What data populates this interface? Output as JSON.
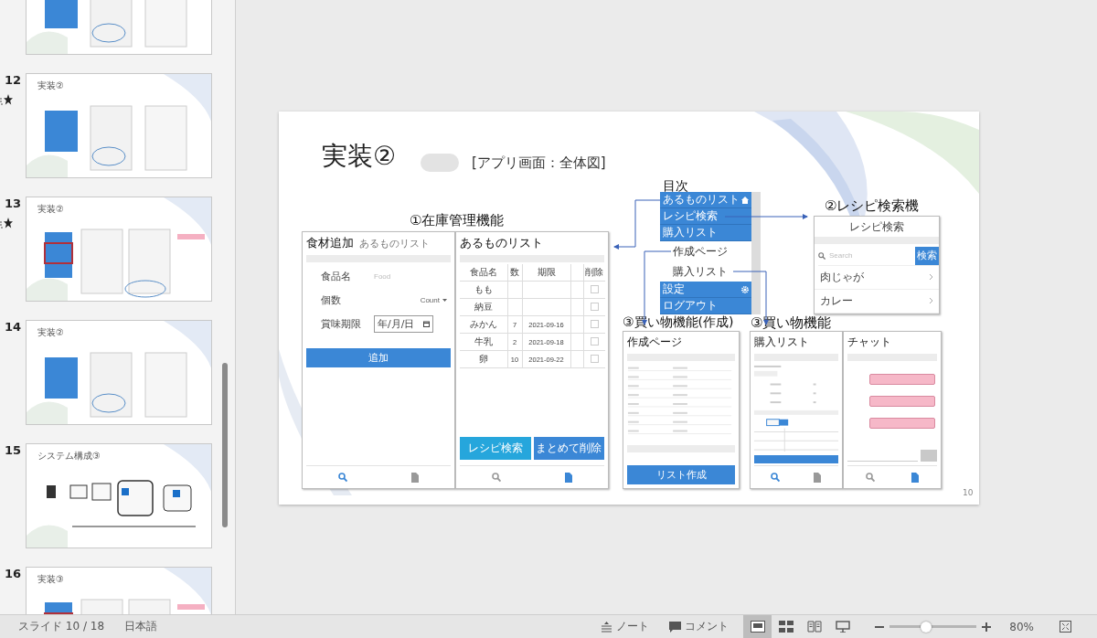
{
  "thumbnails": [
    {
      "starred": false
    },
    {
      "number": "12",
      "title": "実装②",
      "starred": true
    },
    {
      "number": "13",
      "title": "実装②",
      "starred": true
    },
    {
      "number": "14",
      "title": "実装②",
      "starred": false
    },
    {
      "number": "15",
      "title": "システム構成③",
      "starred": false
    },
    {
      "number": "16",
      "title": "実装③",
      "starred": false
    }
  ],
  "slide": {
    "title": "実装②",
    "subtitle": "[アプリ画面：全体図]",
    "page_number": "10",
    "inventory": {
      "label": "①在庫管理機能",
      "add_screen": {
        "title": "食材追加",
        "subtitle": "あるものリスト",
        "fields": [
          {
            "label": "食品名",
            "placeholder": "Food"
          },
          {
            "label": "個数",
            "value": "Count"
          },
          {
            "label": "賞味期限",
            "value": "年/月/日"
          }
        ],
        "button": "追加"
      },
      "list_screen": {
        "title": "あるものリスト",
        "headers": {
          "name": "食品名",
          "count": "数",
          "expires": "期限",
          "delete": "削除"
        },
        "rows": [
          {
            "name": "もも",
            "checked": false
          },
          {
            "name": "納豆",
            "checked": false
          },
          {
            "name": "みかん",
            "count": "7",
            "expires": "2021-09-16",
            "checked": false
          },
          {
            "name": "牛乳",
            "count": "2",
            "expires": "2021-09-18",
            "checked": false
          },
          {
            "name": "卵",
            "count": "10",
            "expires": "2021-09-22",
            "checked": false
          }
        ],
        "buttons": [
          "レシピ検索",
          "まとめて削除"
        ]
      }
    },
    "menu": {
      "label": "目次",
      "items": [
        {
          "kind": "home",
          "label": "あるものリスト"
        },
        {
          "kind": "primary",
          "label": "レシピ検索"
        },
        {
          "kind": "primary",
          "label": "購入リスト"
        },
        {
          "kind": "sub",
          "label": "作成ページ"
        },
        {
          "kind": "sub",
          "label": "購入リスト"
        },
        {
          "kind": "settings",
          "label": "設定"
        },
        {
          "kind": "primary",
          "label": "ログアウト"
        }
      ]
    },
    "recipe": {
      "label": "②レシピ検索機",
      "title": "レシピ検索",
      "placeholder": "Search",
      "button": "検索",
      "results": [
        "肉じゃが",
        "カレー"
      ]
    },
    "shopping_create": {
      "label": "③買い物機能(作成)",
      "title": "作成ページ",
      "button": "リスト作成"
    },
    "shopping": {
      "label": "③買い物機能",
      "list_title": "購入リスト",
      "chat_title": "チャット"
    }
  },
  "status_bar": {
    "slide": "スライド 10 / 18",
    "language": "日本語",
    "notes": "ノート",
    "comments": "コメント",
    "views": [
      {
        "kind": "normal",
        "selected": true
      },
      {
        "kind": "sorter",
        "selected": false
      },
      {
        "kind": "reading",
        "selected": false
      },
      {
        "kind": "slideshow",
        "selected": false
      }
    ],
    "zoom": {
      "level": 0.42,
      "reading": "80%"
    }
  }
}
